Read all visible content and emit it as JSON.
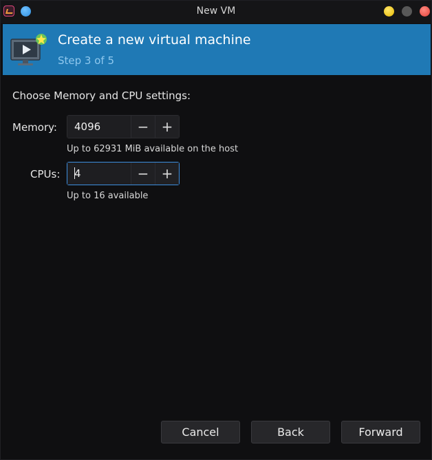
{
  "window": {
    "title": "New VM"
  },
  "header": {
    "title": "Create a new virtual machine",
    "step": "Step 3 of 5",
    "banner_color": "#1f79b5"
  },
  "main": {
    "section_label": "Choose Memory and CPU settings:",
    "memory": {
      "label": "Memory:",
      "value": "4096",
      "decrement": "−",
      "increment": "+",
      "hint": "Up to 62931 MiB available on the host"
    },
    "cpus": {
      "label": "CPUs:",
      "value": "4",
      "decrement": "−",
      "increment": "+",
      "hint": "Up to 16 available"
    }
  },
  "footer": {
    "cancel_label": "Cancel",
    "back_label": "Back",
    "forward_label": "Forward"
  },
  "icons": {
    "app": "virt-manager-icon",
    "header": "monitor-play-icon"
  },
  "colors": {
    "accent": "#1f79b5",
    "focus": "#3d8fe0",
    "close": "#e4413a",
    "minimize": "#e5b800"
  }
}
